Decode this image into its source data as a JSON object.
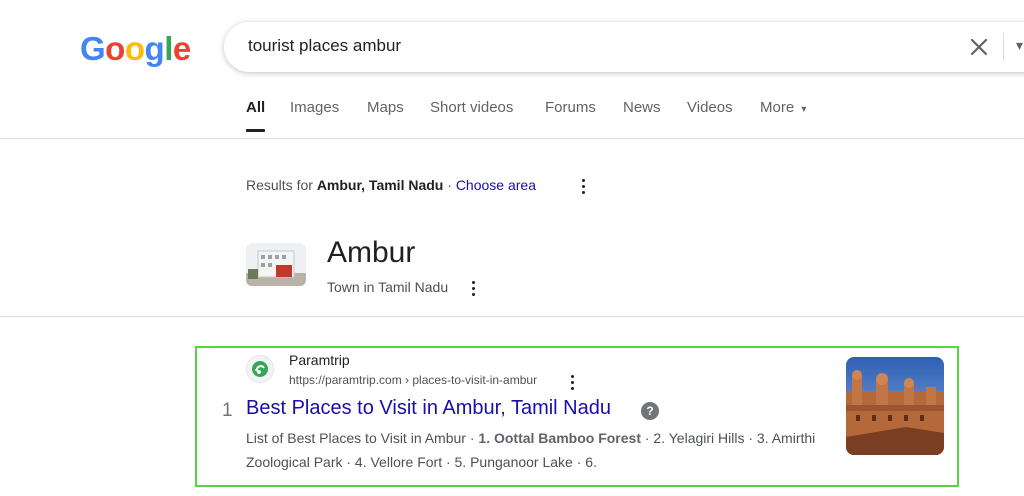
{
  "logo": {
    "letters": [
      "G",
      "o",
      "o",
      "g",
      "l",
      "e"
    ],
    "colors": [
      "#4285F4",
      "#EA4335",
      "#FBBC05",
      "#4285F4",
      "#34A853",
      "#EA4335"
    ]
  },
  "search": {
    "query": "tourist places ambur",
    "clear_icon": "close-icon",
    "more_icon": "chevron-down-icon"
  },
  "tabs": [
    {
      "label": "All",
      "active": true
    },
    {
      "label": "Images",
      "active": false
    },
    {
      "label": "Maps",
      "active": false
    },
    {
      "label": "Short videos",
      "active": false
    },
    {
      "label": "Forums",
      "active": false
    },
    {
      "label": "News",
      "active": false
    },
    {
      "label": "Videos",
      "active": false
    },
    {
      "label": "More",
      "active": false
    }
  ],
  "location": {
    "prefix": "Results for",
    "place": "Ambur, Tamil Nadu",
    "separator": "·",
    "action": "Choose area"
  },
  "entity": {
    "title": "Ambur",
    "subtitle": "Town in Tamil Nadu"
  },
  "result": {
    "rank": "1",
    "site_name": "Paramtrip",
    "url": "https://paramtrip.com › places-to-visit-in-ambur",
    "title": "Best Places to Visit in Ambur, Tamil Nadu",
    "help_icon": "?",
    "snippet_1": "List of Best Places to Visit in Ambur · ",
    "snippet_bold": "1. Oottal Bamboo Forest",
    "snippet_2": " · 2. Yelagiri Hills · 3. Amirthi Zoological Park · 4. Vellore Fort · 5. Punganoor Lake · 6.",
    "highlight_color": "#5ad246"
  }
}
